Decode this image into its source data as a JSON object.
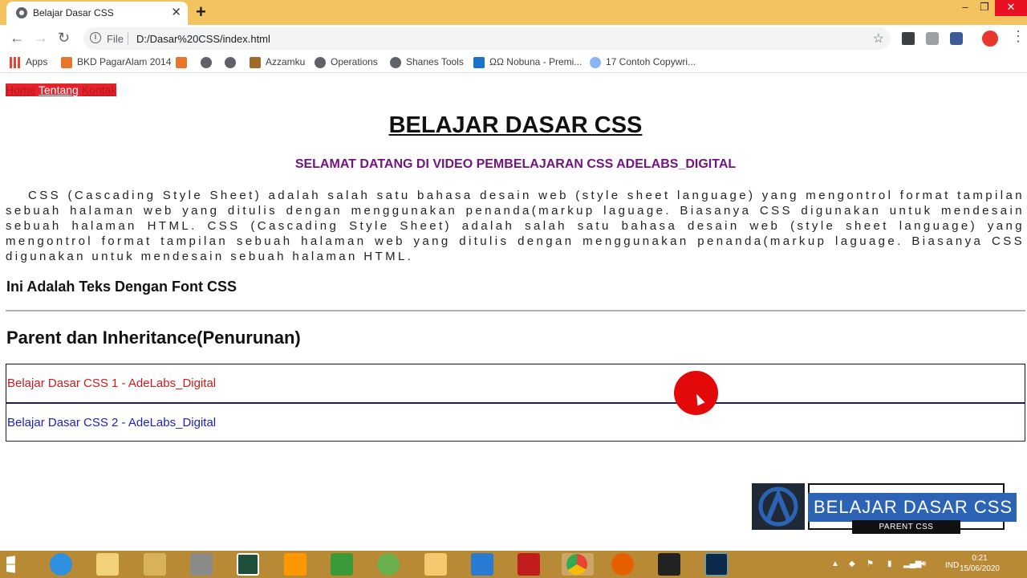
{
  "browser": {
    "tab_title": "Belajar Dasar CSS",
    "scheme_label": "File",
    "url": "D:/Dasar%20CSS/index.html",
    "bookmarks": [
      {
        "label": "Apps"
      },
      {
        "label": "BKD PagarAlam 2014"
      },
      {
        "label": ""
      },
      {
        "label": ""
      },
      {
        "label": ""
      },
      {
        "label": "Azzamku"
      },
      {
        "label": "Operations"
      },
      {
        "label": "Shanes Tools"
      },
      {
        "label": "ΩΩ Nobuna - Premi..."
      },
      {
        "label": "17 Contoh Copywri..."
      }
    ]
  },
  "page": {
    "nav": [
      "Home",
      "Tentang",
      "Kontak"
    ],
    "title": "BELAJAR DASAR CSS",
    "subtitle": "SELAMAT DATANG DI VIDEO PEMBELAJARAN CSS ADELABS_DIGITAL",
    "paragraph": "CSS (Cascading Style Sheet) adalah salah satu bahasa desain web (style sheet language) yang mengontrol format tampilan sebuah halaman web yang ditulis dengan menggunakan penanda(markup laguage. Biasanya CSS digunakan untuk mendesain sebuah halaman HTML. CSS (Cascading Style Sheet) adalah salah satu bahasa desain web (style sheet language) yang mengontrol format tampilan sebuah halaman web yang ditulis dengan menggunakan penanda(markup laguage. Biasanya CSS digunakan untuk mendesain sebuah halaman HTML.",
    "font_heading": "Ini Adalah Teks Dengan Font CSS",
    "section_heading": "Parent dan Inheritance(Penurunan)",
    "box1": "Belajar Dasar CSS 1 - AdeLabs_Digital",
    "box2": "Belajar Dasar CSS 2 - AdeLabs_Digital"
  },
  "watermark": {
    "title": "BELAJAR DASAR CSS",
    "subtitle": "PARENT CSS"
  },
  "taskbar": {
    "language": "IND",
    "time": "0:21",
    "date": "15/06/2020"
  },
  "colors": {
    "tabbar": "#f2c35f",
    "nav_bg": "#e6222b",
    "subtitle": "#73137f",
    "box1_text": "#c81c1c",
    "box2_text": "#1e1eb8",
    "taskbar": "#b98a35"
  }
}
